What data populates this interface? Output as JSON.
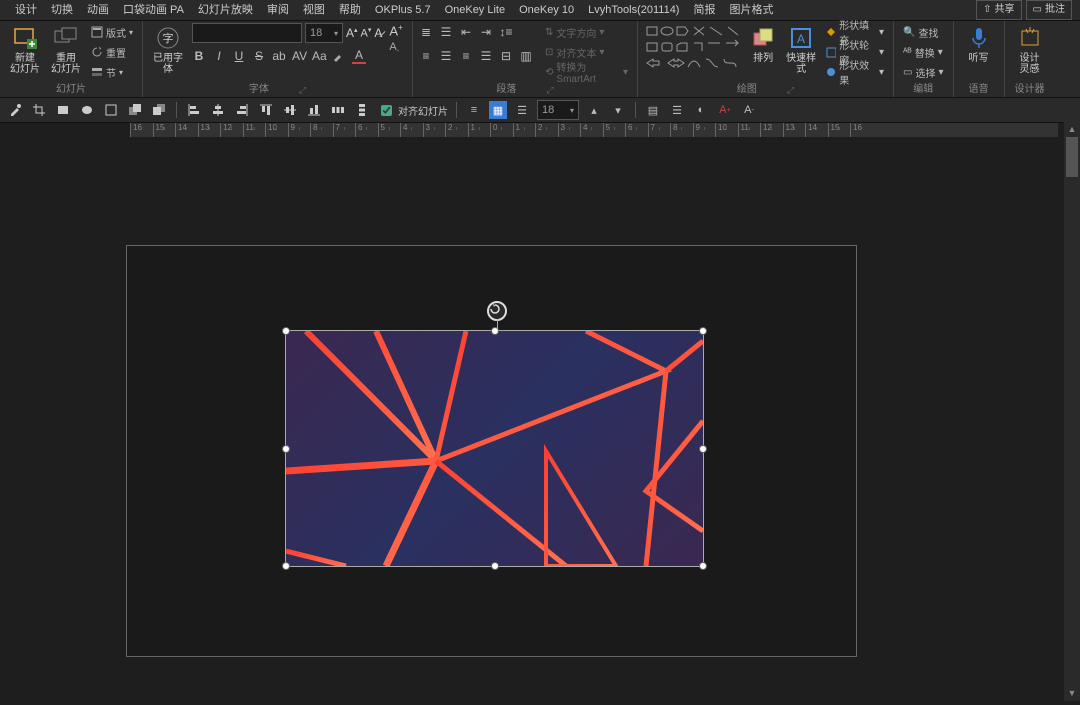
{
  "title_tabs": [
    "设计",
    "切换",
    "动画",
    "口袋动画 PA",
    "幻灯片放映",
    "审阅",
    "视图",
    "帮助",
    "OKPlus 5.7",
    "OneKey Lite",
    "OneKey 10",
    "LvyhTools(201114)",
    "简报",
    "图片格式"
  ],
  "title_btns": {
    "share": "共享",
    "comment": "批注"
  },
  "ribbon": {
    "slides": {
      "new": "新建\n幻灯片",
      "reuse": "重用\n幻灯片",
      "layout": "版式",
      "reset": "重置",
      "section": "节",
      "label": "幻灯片"
    },
    "font": {
      "usedfont": "已用字\n体",
      "size": "18",
      "label": "字体"
    },
    "para": {
      "dir": "文字方向",
      "align": "对齐文本",
      "smart": "转换为 SmartArt",
      "label": "段落"
    },
    "draw": {
      "arrange": "排列",
      "quick": "快速样式",
      "fill": "形状填充",
      "outline": "形状轮廓",
      "effect": "形状效果",
      "label": "绘图"
    },
    "edit": {
      "find": "查找",
      "replace": "替换",
      "select": "选择",
      "label": "编辑"
    },
    "voice": {
      "dictate": "听写",
      "label": "语音"
    },
    "designer": {
      "ideas": "设计\n灵感",
      "label": "设计器"
    }
  },
  "qat": {
    "alignchk": "对齐幻灯片",
    "size2": "18"
  },
  "ruler_marks": [
    "16",
    "15",
    "14",
    "13",
    "12",
    "11",
    "10",
    "9",
    "8",
    "7",
    "6",
    "5",
    "4",
    "3",
    "2",
    "1",
    "0",
    "1",
    "2",
    "3",
    "4",
    "5",
    "6",
    "7",
    "8",
    "9",
    "10",
    "11",
    "12",
    "13",
    "14",
    "15",
    "16"
  ]
}
